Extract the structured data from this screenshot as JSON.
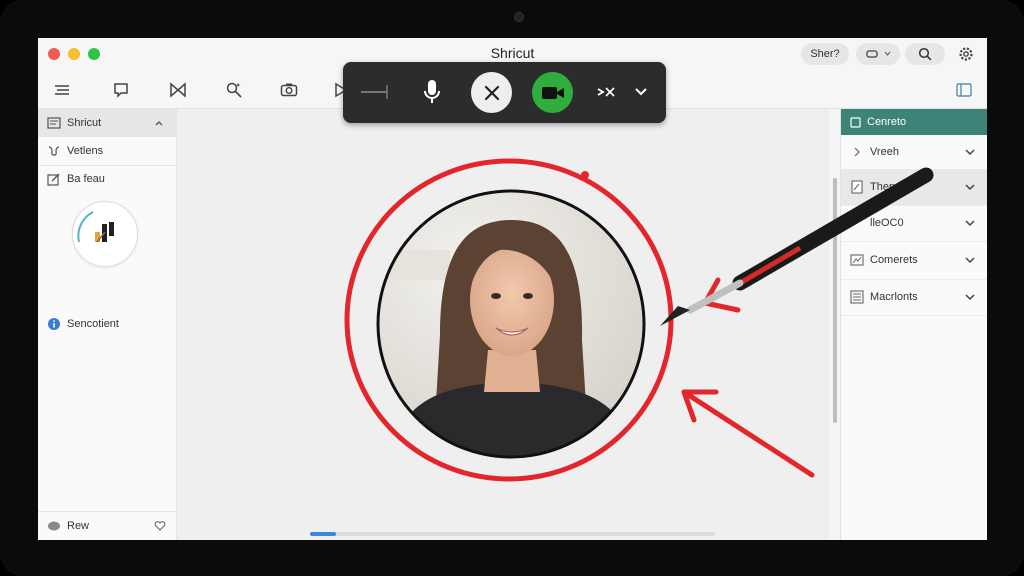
{
  "window": {
    "title": "Shricut",
    "share_label": "Sher?"
  },
  "sidebar": {
    "items": [
      {
        "label": "Shricut",
        "icon": "library-icon"
      },
      {
        "label": "Vetlens",
        "icon": "effects-icon"
      },
      {
        "label": "Ba feau",
        "icon": "edit-icon"
      },
      {
        "label": "Sencotient",
        "icon": "info-icon"
      }
    ],
    "footer_label": "Rew"
  },
  "right_panel": {
    "header": "Cenreto",
    "items": [
      {
        "label": "Vreeh",
        "icon": "chevron-right-icon"
      },
      {
        "label": "Thepe",
        "icon": "document-icon"
      },
      {
        "label": "lleOC0",
        "icon": "none"
      },
      {
        "label": "Comerets",
        "icon": "image-icon"
      },
      {
        "label": "Macrlonts",
        "icon": "list-icon"
      }
    ]
  },
  "colors": {
    "accent_green": "#2fad3e",
    "panel_header": "#3e8378",
    "annotation_red": "#e3262b",
    "overlay_bg": "#2c2c2c"
  }
}
